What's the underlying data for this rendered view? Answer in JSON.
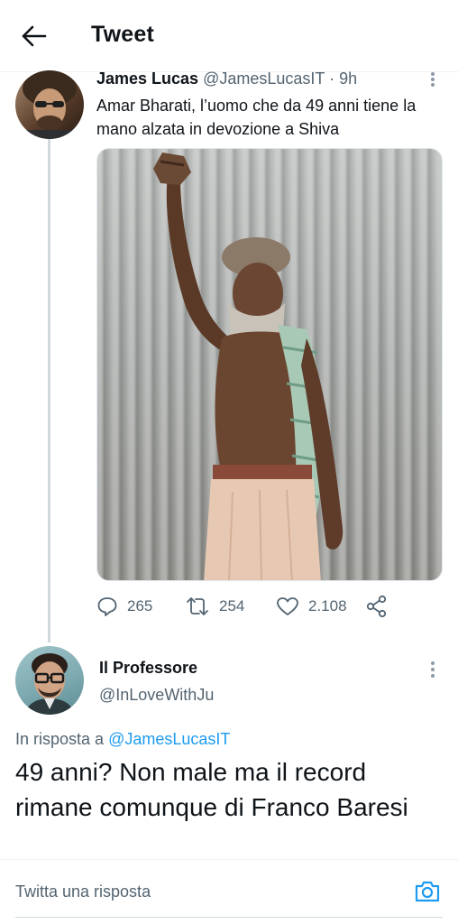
{
  "header": {
    "title": "Tweet",
    "back_icon": "arrow-left-icon"
  },
  "tweet": {
    "author_name": "James Lucas",
    "author_handle": "@JamesLucasIT",
    "separator": "·",
    "time": "9h",
    "text": "Amar Bharati, l’uomo che da 49 anni tiene la mano alzata in devozione a Shiva",
    "image_subject": "photo",
    "stats": {
      "replies": "265",
      "retweets": "254",
      "likes": "2.108"
    },
    "icons": {
      "reply": "reply-icon",
      "retweet": "retweet-icon",
      "like": "heart-icon",
      "share": "share-icon",
      "more": "more-options-icon"
    }
  },
  "reply": {
    "author_name": "Il Professore",
    "author_handle": "@InLoveWithJu",
    "replying_to_prefix": "In risposta a",
    "replying_to_handle": "@JamesLucasIT",
    "text": "49 anni? Non male ma il record rimane comunque di Franco Baresi"
  },
  "composer": {
    "placeholder": "Twitta una risposta",
    "camera_icon": "camera-icon"
  },
  "colors": {
    "accent": "#1d9bf0",
    "text_primary": "#0f1419",
    "text_secondary": "#536471",
    "divider": "#eff3f4"
  }
}
